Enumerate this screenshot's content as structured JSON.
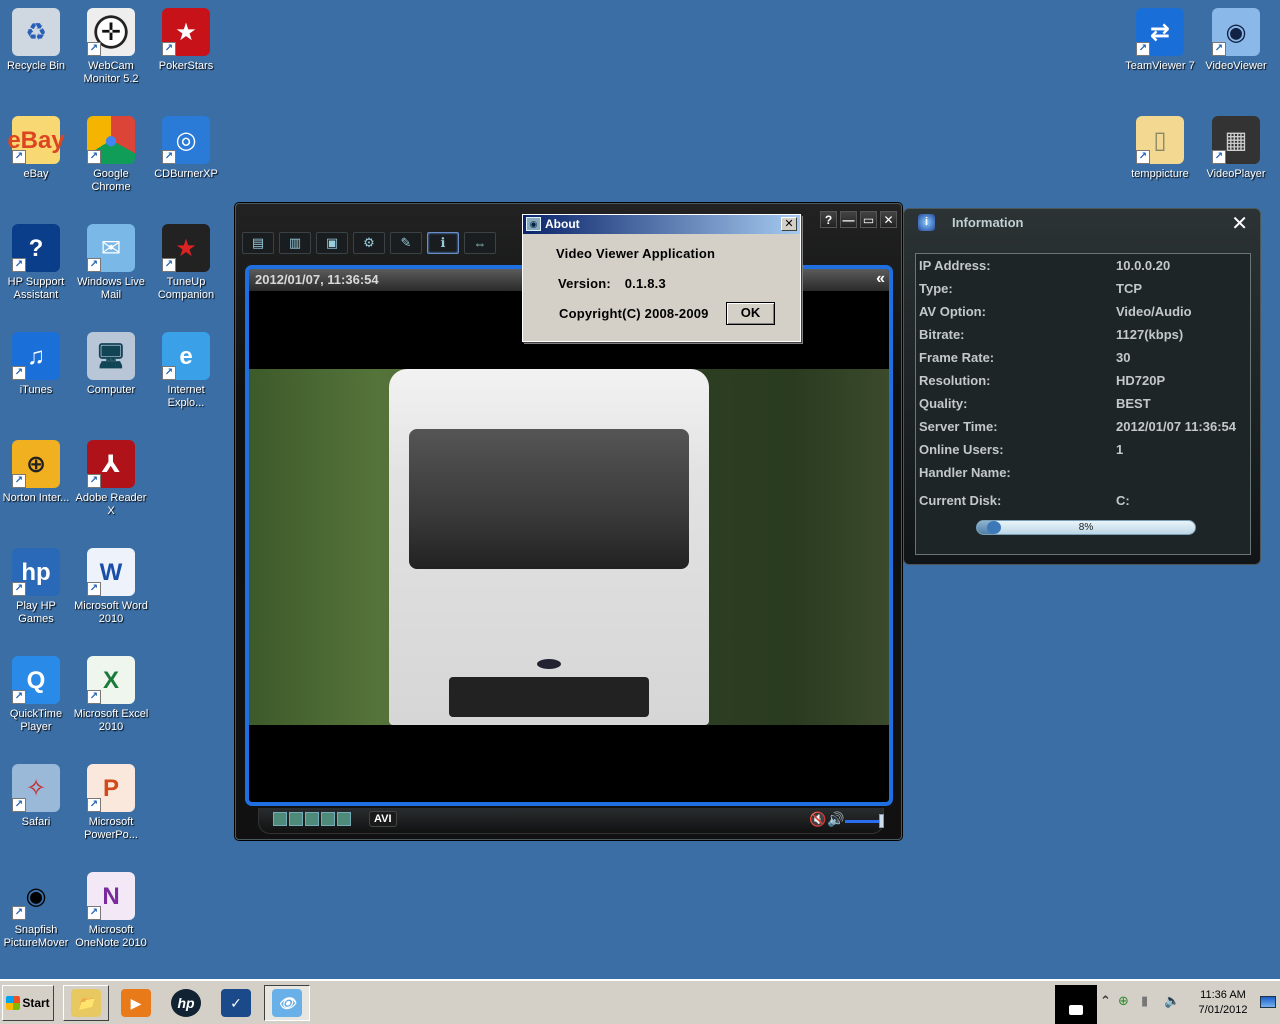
{
  "desktop": {
    "background_color": "#3a6ea5",
    "icons_left": [
      {
        "label": "Recycle Bin",
        "icon": "recycle-bin-icon",
        "shortcut": false
      },
      {
        "label": "WebCam Monitor 5.2",
        "icon": "webcam-monitor-icon",
        "shortcut": true
      },
      {
        "label": "PokerStars",
        "icon": "pokerstars-icon",
        "shortcut": true
      },
      {
        "label": "eBay",
        "icon": "ebay-icon",
        "shortcut": true
      },
      {
        "label": "Google Chrome",
        "icon": "chrome-icon",
        "shortcut": true
      },
      {
        "label": "CDBurnerXP",
        "icon": "cdburner-icon",
        "shortcut": true
      },
      {
        "label": "HP Support Assistant",
        "icon": "hp-support-icon",
        "shortcut": true
      },
      {
        "label": "Windows Live Mail",
        "icon": "mail-icon",
        "shortcut": true
      },
      {
        "label": "TuneUp Companion",
        "icon": "tuneup-icon",
        "shortcut": true
      },
      {
        "label": "iTunes",
        "icon": "itunes-icon",
        "shortcut": true
      },
      {
        "label": "Computer",
        "icon": "computer-icon",
        "shortcut": false
      },
      {
        "label": "Internet Explo...",
        "icon": "internet-explorer-icon",
        "shortcut": true
      },
      {
        "label": "Norton Inter...",
        "icon": "norton-icon",
        "shortcut": true
      },
      {
        "label": "Adobe Reader X",
        "icon": "adobe-reader-icon",
        "shortcut": true
      },
      {
        "label": "Play HP Games",
        "icon": "hp-games-icon",
        "shortcut": true
      },
      {
        "label": "Microsoft Word 2010",
        "icon": "word-icon",
        "shortcut": true
      },
      {
        "label": "QuickTime Player",
        "icon": "quicktime-icon",
        "shortcut": true
      },
      {
        "label": "Microsoft Excel 2010",
        "icon": "excel-icon",
        "shortcut": true
      },
      {
        "label": "Safari",
        "icon": "safari-icon",
        "shortcut": true
      },
      {
        "label": "Microsoft PowerPo...",
        "icon": "powerpoint-icon",
        "shortcut": true
      },
      {
        "label": "Snapfish PictureMover",
        "icon": "snapfish-icon",
        "shortcut": true
      },
      {
        "label": "Microsoft OneNote 2010",
        "icon": "onenote-icon",
        "shortcut": true
      }
    ],
    "icons_right": [
      {
        "label": "TeamViewer 7",
        "icon": "teamviewer-icon",
        "shortcut": true
      },
      {
        "label": "VideoViewer",
        "icon": "videoviewer-icon",
        "shortcut": true
      },
      {
        "label": "temppicture",
        "icon": "folder-icon",
        "shortcut": true
      },
      {
        "label": "VideoPlayer",
        "icon": "videoplayer-icon",
        "shortcut": true
      }
    ]
  },
  "video_viewer": {
    "toolbar": [
      {
        "name": "address-book",
        "glyph": "▤"
      },
      {
        "name": "record-list",
        "glyph": "▥"
      },
      {
        "name": "snapshot-folder",
        "glyph": "▣"
      },
      {
        "name": "settings",
        "glyph": "⚙"
      },
      {
        "name": "ptz-control",
        "glyph": "✎"
      },
      {
        "name": "information",
        "glyph": "ℹ"
      },
      {
        "name": "fullscreen",
        "glyph": "⇔"
      }
    ],
    "window_buttons": {
      "help": "?",
      "minimize": "—",
      "maximize": "▭",
      "close": "✕"
    },
    "video_timestamp": "2012/01/07, 11:36:54",
    "collapse_glyph": "«",
    "avi_label": "AVI",
    "volume_level": 1.0
  },
  "about_dialog": {
    "title": "About",
    "close_glyph": "✕",
    "app_name": "Video Viewer Application",
    "version_label": "Version:",
    "version_value": "0.1.8.3",
    "copyright": "Copyright(C) 2008-2009",
    "ok_label": "OK"
  },
  "info_panel": {
    "title": "Information",
    "close_glyph": "✕",
    "rows": [
      {
        "key": "IP Address:",
        "value": "10.0.0.20"
      },
      {
        "key": "Type:",
        "value": "TCP"
      },
      {
        "key": "AV Option:",
        "value": "Video/Audio"
      },
      {
        "key": "Bitrate:",
        "value": "1127(kbps)"
      },
      {
        "key": "Frame Rate:",
        "value": "30"
      },
      {
        "key": "Resolution:",
        "value": "HD720P"
      },
      {
        "key": "Quality:",
        "value": "BEST"
      },
      {
        "key": "Server Time:",
        "value": "2012/01/07 11:36:54"
      },
      {
        "key": "Online Users:",
        "value": "1"
      },
      {
        "key": "Handler Name:",
        "value": ""
      },
      {
        "key": "Current Disk:",
        "value": "C:"
      }
    ],
    "disk_usage_percent": 8,
    "disk_usage_label": "8%"
  },
  "taskbar": {
    "start_label": "Start",
    "items": [
      {
        "name": "windows-explorer",
        "glyph": "📁",
        "state": "raised"
      },
      {
        "name": "media-player",
        "glyph": "▶",
        "state": "normal"
      },
      {
        "name": "hp",
        "glyph": "hp",
        "state": "normal"
      },
      {
        "name": "checkmark-app",
        "glyph": "✓",
        "state": "normal"
      },
      {
        "name": "video-viewer",
        "glyph": "👁",
        "state": "pressed"
      }
    ],
    "clock_time": "11:36 AM",
    "clock_date": "7/01/2012"
  }
}
